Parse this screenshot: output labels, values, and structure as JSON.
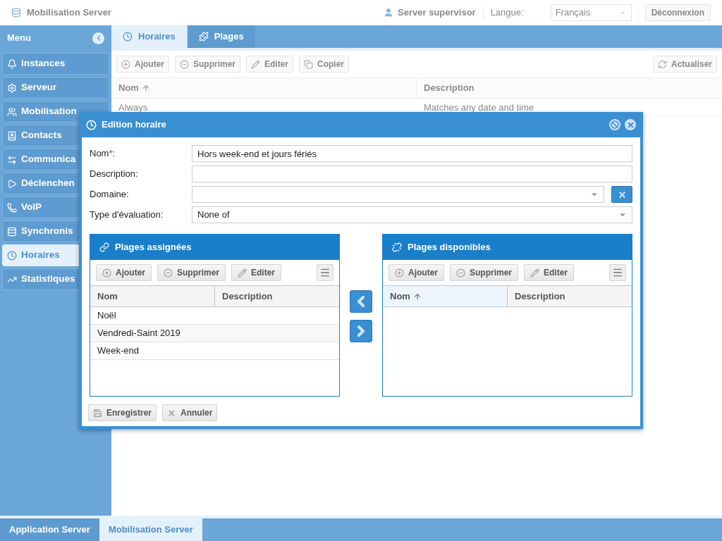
{
  "header": {
    "app_title": "Mobilisation Server",
    "user": "Server supervisor",
    "language_label": "Langue:",
    "language_value": "Français",
    "logout": "Déconnexion"
  },
  "sidebar": {
    "title": "Menu",
    "items": [
      {
        "label": "Instances",
        "selected": false
      },
      {
        "label": "Serveur",
        "selected": false
      },
      {
        "label": "Mobilisation",
        "selected": false
      },
      {
        "label": "Contacts",
        "selected": false
      },
      {
        "label": "Communica",
        "selected": false
      },
      {
        "label": "Déclenchen",
        "selected": false
      },
      {
        "label": "VoIP",
        "selected": false
      },
      {
        "label": "Synchronis",
        "selected": false
      },
      {
        "label": "Horaires",
        "selected": true
      },
      {
        "label": "Statistiques",
        "selected": false
      }
    ]
  },
  "tabs": [
    {
      "label": "Horaires",
      "selected": true
    },
    {
      "label": "Plages",
      "selected": false
    }
  ],
  "toolbar": {
    "buttons": [
      "Ajouter",
      "Supprimer",
      "Editer",
      "Copier"
    ],
    "refresh": "Actualiser"
  },
  "table": {
    "columns": [
      {
        "label": "Nom",
        "sorted": true
      },
      {
        "label": "Description",
        "sorted": false
      }
    ],
    "rows": [
      {
        "cells": [
          "Always",
          "Matches any date and time"
        ]
      }
    ]
  },
  "dialog": {
    "title": "Edition horaire",
    "fields": [
      {
        "kind": "text",
        "label": "Nom",
        "required_mark": "*",
        "label_end": ":",
        "value": "Hors week-end et jours fériés"
      },
      {
        "kind": "text",
        "label": "Description:"
      },
      {
        "kind": "select_clear",
        "label": "Domaine:"
      },
      {
        "kind": "select",
        "label": "Type d'évaluation:",
        "value": "None of"
      }
    ],
    "assigned": {
      "title": "Plages assignées",
      "buttons": [
        "Ajouter",
        "Supprimer",
        "Editer"
      ],
      "columns": [
        {
          "label": "Nom",
          "sorted": false
        },
        {
          "label": "Description",
          "sorted": false
        }
      ],
      "rows": [
        {
          "cells": [
            "Noël"
          ]
        },
        {
          "cells": [
            "Vendredi-Saint 2019"
          ]
        },
        {
          "cells": [
            "Week-end"
          ]
        }
      ]
    },
    "available": {
      "title": "Plages disponibles",
      "buttons": [
        "Ajouter",
        "Supprimer",
        "Editer"
      ],
      "columns": [
        {
          "label": "Nom",
          "sorted": true
        },
        {
          "label": "Description",
          "sorted": false
        }
      ]
    },
    "buttons": [
      "Enregistrer",
      "Annuler"
    ]
  },
  "bottom_tabs": [
    {
      "label": "Application Server",
      "selected": false
    },
    {
      "label": "Mobilisation Server",
      "selected": true
    }
  ]
}
